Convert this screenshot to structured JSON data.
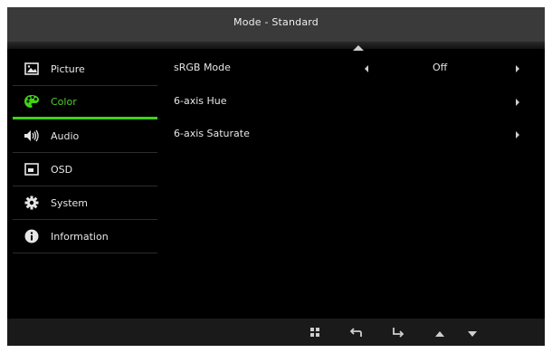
{
  "header": {
    "title": "Mode - Standard"
  },
  "sidebar": {
    "items": [
      {
        "label": "Picture",
        "icon": "picture-icon",
        "active": false
      },
      {
        "label": "Color",
        "icon": "palette-icon",
        "active": true
      },
      {
        "label": "Audio",
        "icon": "speaker-icon",
        "active": false
      },
      {
        "label": "OSD",
        "icon": "osd-icon",
        "active": false
      },
      {
        "label": "System",
        "icon": "gear-icon",
        "active": false
      },
      {
        "label": "Information",
        "icon": "info-icon",
        "active": false
      }
    ]
  },
  "content": {
    "rows": [
      {
        "label": "sRGB Mode",
        "value": "Off"
      },
      {
        "label": "6-axis Hue"
      },
      {
        "label": "6-axis Saturate"
      }
    ]
  },
  "footer": {
    "buttons": [
      "menu-grid-icon",
      "back-icon",
      "enter-icon",
      "up-icon",
      "down-icon"
    ]
  },
  "colors": {
    "accent": "#3fd216",
    "background": "#000000",
    "header": "#3a3a3a"
  }
}
